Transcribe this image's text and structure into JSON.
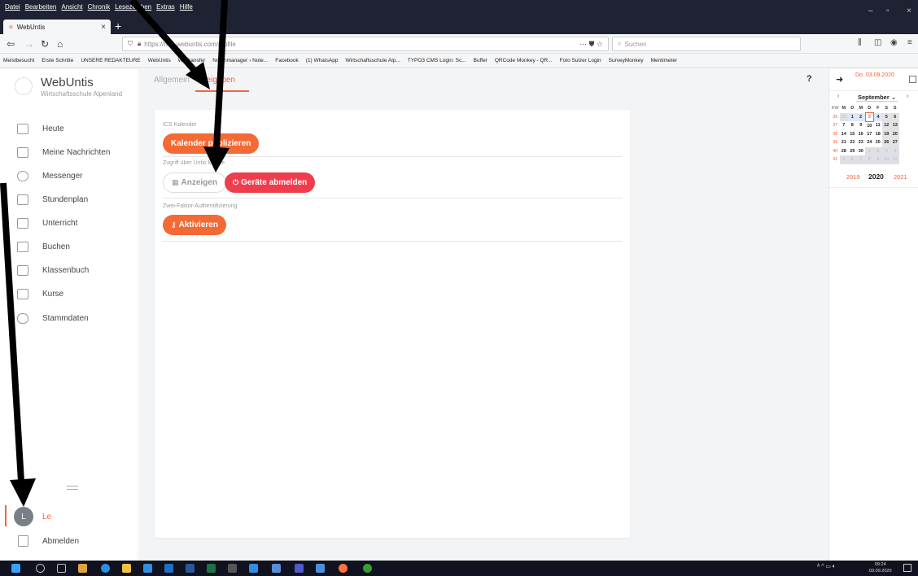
{
  "browser": {
    "menu": [
      "Datei",
      "Bearbeiten",
      "Ansicht",
      "Chronik",
      "Lesezeichen",
      "Extras",
      "Hilfe"
    ],
    "tab_title": "WebUntis",
    "url": "https://neo.webuntis.com/profile",
    "search_placeholder": "Suchen",
    "bookmarks": [
      "Meistbesucht",
      "Erste Schritte",
      "UNSERE REDAKTEURE",
      "WebUntis",
      "WeTransfer",
      "Notenmanager › Note...",
      "Facebook",
      "(1) WhatsApp",
      "Wirtschaftsschule Alp...",
      "TYPO3 CMS Login: Sc...",
      "Buffer",
      "QRCode Monkey - QR...",
      "Foto Sulzer Login",
      "SurveyMonkey",
      "Mentimeter"
    ]
  },
  "app": {
    "name": "WebUntis",
    "school": "Wirtschaftsschule Alpenland"
  },
  "sidebar": {
    "items": [
      {
        "label": "Heute",
        "icon": "dashboard-icon"
      },
      {
        "label": "Meine Nachrichten",
        "icon": "mail-icon"
      },
      {
        "label": "Messenger",
        "icon": "chat-icon"
      },
      {
        "label": "Stundenplan",
        "icon": "timetable-icon"
      },
      {
        "label": "Unterricht",
        "icon": "lesson-icon"
      },
      {
        "label": "Buchen",
        "icon": "booking-icon"
      },
      {
        "label": "Klassenbuch",
        "icon": "classbook-icon"
      },
      {
        "label": "Kurse",
        "icon": "courses-icon"
      },
      {
        "label": "Stammdaten",
        "icon": "database-icon"
      }
    ],
    "user_initial": "L",
    "user_name": "Le",
    "logout": "Abmelden"
  },
  "profile": {
    "tabs": {
      "general": "Allgemein",
      "shares": "Freigaben"
    },
    "help": "?",
    "sections": {
      "ics": {
        "label": "ICS Kalender",
        "button": "Kalender publizieren"
      },
      "access": {
        "label": "Zugriff über Untis Mobile",
        "show_button": "Anzeigen",
        "logout_devices_button": "Geräte abmelden"
      },
      "twofa": {
        "label": "Zwei-Faktor-Authentifizierung",
        "button": "Aktivieren"
      }
    }
  },
  "calendar": {
    "date_label": "Do. 03.09.2020",
    "month": "September",
    "kw_header": "KW",
    "weekday_headers": [
      "M",
      "D",
      "M",
      "D",
      "F",
      "S",
      "S"
    ],
    "weeks": [
      {
        "kw": "36",
        "days": [
          "31",
          "1",
          "2",
          "3",
          "4",
          "5",
          "6"
        ]
      },
      {
        "kw": "37",
        "days": [
          "7",
          "8",
          "9",
          "10",
          "11",
          "12",
          "13"
        ]
      },
      {
        "kw": "38",
        "days": [
          "14",
          "15",
          "16",
          "17",
          "18",
          "19",
          "20"
        ]
      },
      {
        "kw": "39",
        "days": [
          "21",
          "22",
          "23",
          "24",
          "25",
          "26",
          "27"
        ]
      },
      {
        "kw": "40",
        "days": [
          "28",
          "29",
          "30",
          "1",
          "2",
          "3",
          "4"
        ]
      },
      {
        "kw": "41",
        "days": [
          "5",
          "6",
          "7",
          "8",
          "9",
          "10",
          "11"
        ]
      }
    ],
    "years": {
      "prev": "2019",
      "current": "2020",
      "next": "2021"
    }
  },
  "taskbar": {
    "time": "09:24",
    "date": "03.09.2020"
  },
  "colors": {
    "accent": "#f3643c",
    "danger": "#ef3d4d",
    "chrome_dark": "#1f2233"
  }
}
